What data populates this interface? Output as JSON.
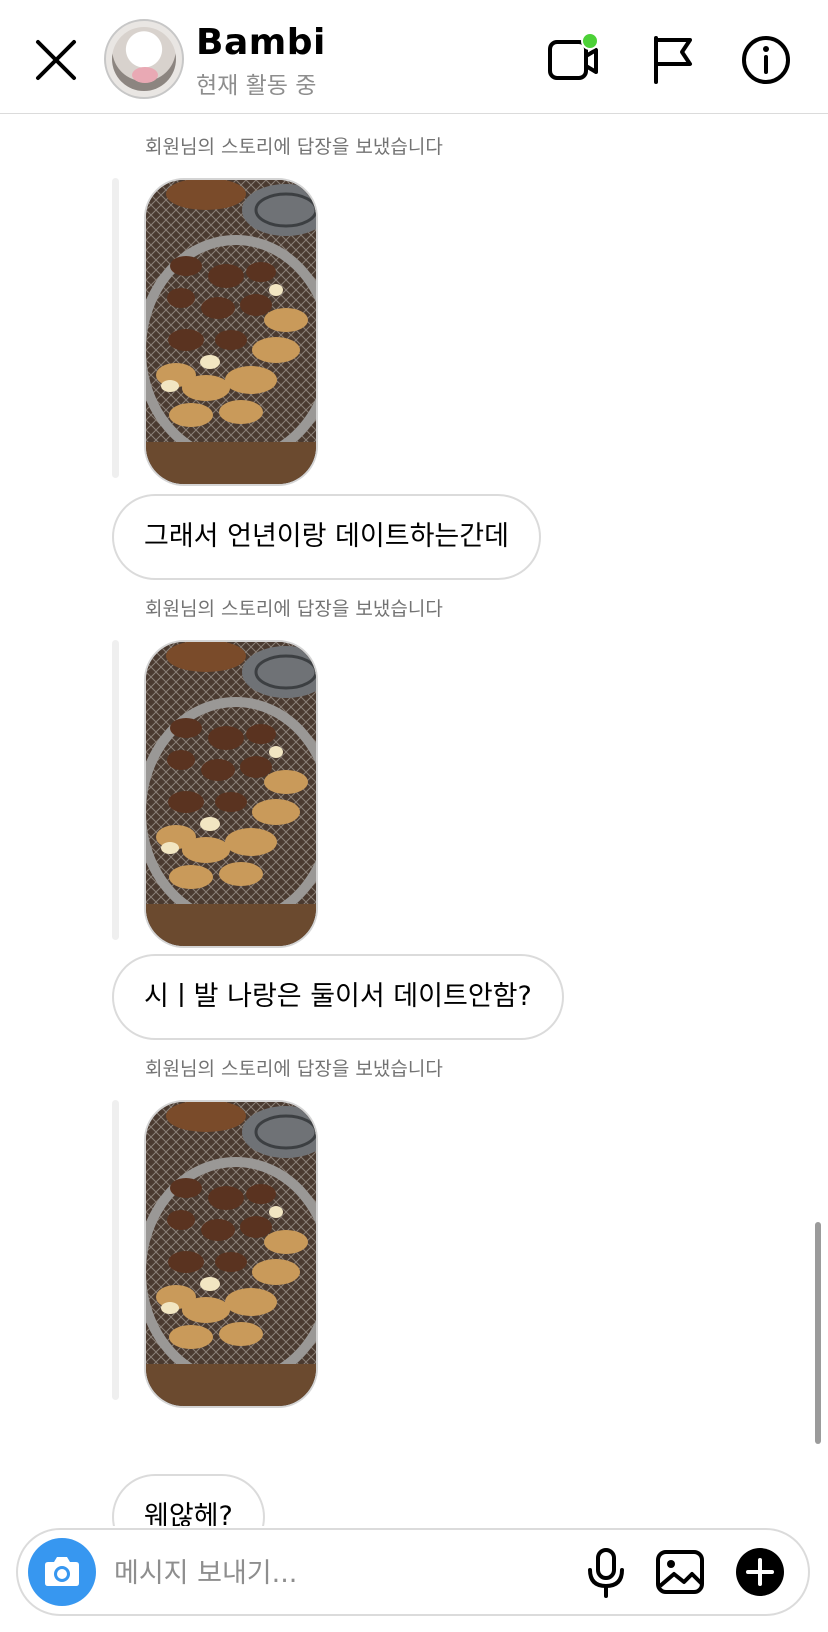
{
  "header": {
    "name": "Bambi",
    "status": "현재 활동 중",
    "active_dot_color": "#4cd137"
  },
  "messages": [
    {
      "kind": "story_reply",
      "label": "회원님의 스토리에 답장을 보냈습니다"
    },
    {
      "kind": "text",
      "text": "그래서 언년이랑 데이트하는간데"
    },
    {
      "kind": "story_reply",
      "label": "회원님의 스토리에 답장을 보냈습니다"
    },
    {
      "kind": "text",
      "text": "시ㅣ발 나랑은 둘이서 데이트안함?"
    },
    {
      "kind": "story_reply",
      "label": "회원님의 스토리에 답장을 보냈습니다"
    },
    {
      "kind": "text",
      "text": "웨않헤?"
    }
  ],
  "composer": {
    "placeholder": "메시지 보내기...",
    "accent_color": "#3797f0"
  },
  "icons": {
    "close": "close-icon",
    "video": "video-call-icon",
    "flag": "flag-icon",
    "info": "info-icon",
    "camera": "camera-icon",
    "mic": "microphone-icon",
    "gallery": "gallery-icon",
    "plus": "plus-icon"
  }
}
